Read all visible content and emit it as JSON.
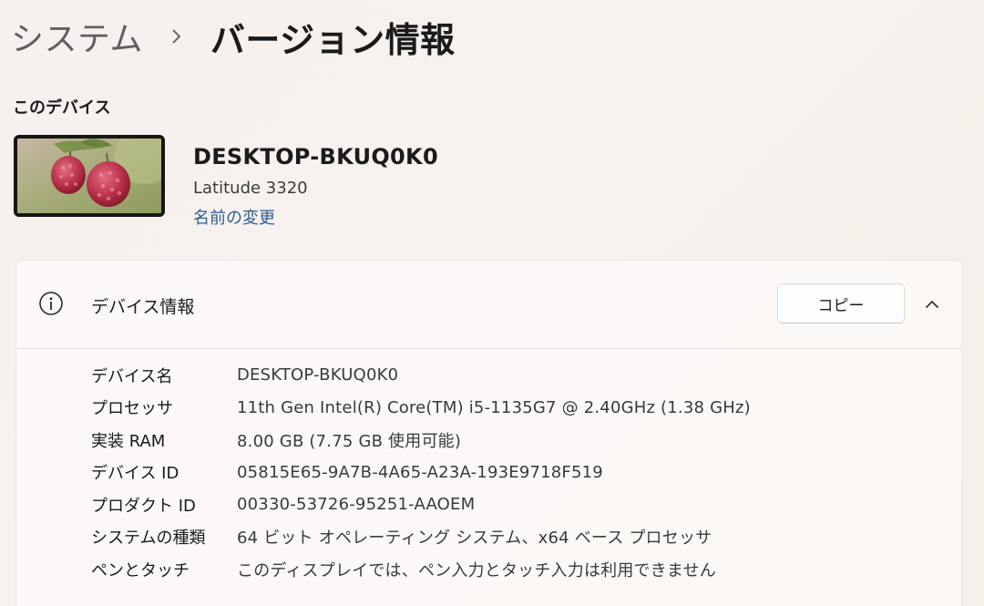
{
  "breadcrumb": {
    "parent": "システム",
    "current": "バージョン情報"
  },
  "this_device": {
    "section_label": "このデバイス",
    "device_name": "DESKTOP-BKUQ0K0",
    "model": "Latitude 3320",
    "rename_link": "名前の変更"
  },
  "device_specs": {
    "title": "デバイス情報",
    "copy_label": "コピー",
    "rows": [
      {
        "label": "デバイス名",
        "value": "DESKTOP-BKUQ0K0"
      },
      {
        "label": "プロセッサ",
        "value": "11th Gen Intel(R) Core(TM) i5-1135G7 @ 2.40GHz (1.38 GHz)"
      },
      {
        "label": "実装 RAM",
        "value": "8.00 GB (7.75 GB 使用可能)"
      },
      {
        "label": "デバイス ID",
        "value": "05815E65-9A7B-4A65-A23A-193E9718F519"
      },
      {
        "label": "プロダクト ID",
        "value": "00330-53726-95251-AAOEM"
      },
      {
        "label": "システムの種類",
        "value": "64 ビット オペレーティング システム、x64 ベース プロセッサ"
      },
      {
        "label": "ペンとタッチ",
        "value": "このディスプレイでは、ペン入力とタッチ入力は利用できません"
      }
    ]
  },
  "icons": {
    "breadcrumb_separator": "chevron-right-icon",
    "info": "info-icon",
    "collapse": "chevron-up-icon"
  },
  "colors": {
    "link": "#2d5d93",
    "background": "#f6f0ee"
  }
}
